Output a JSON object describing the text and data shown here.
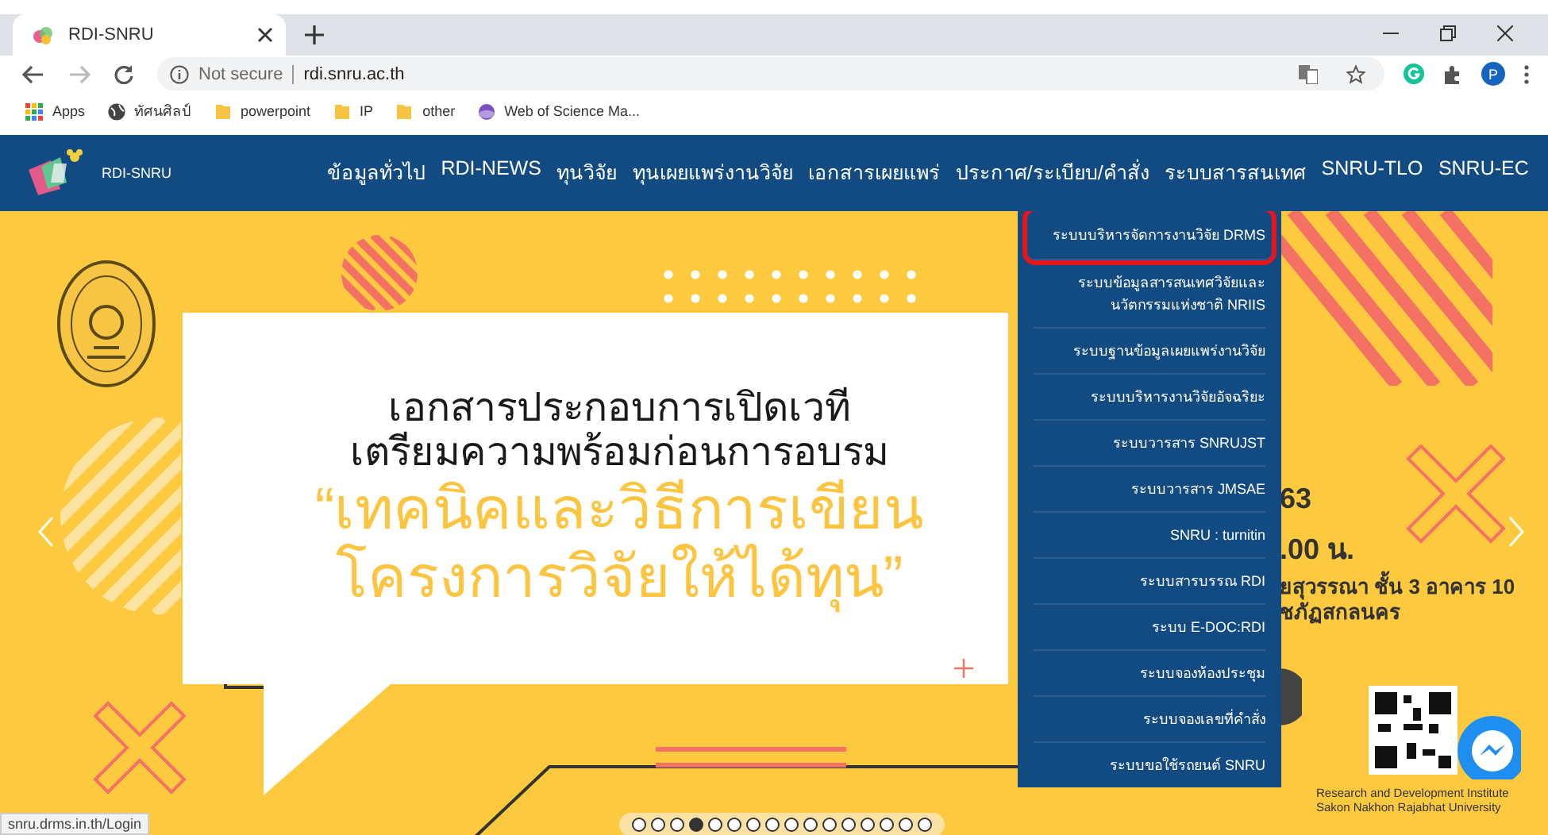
{
  "browser": {
    "tabs": [
      {
        "title": "RDI-SNRU",
        "selected": true
      }
    ],
    "address": {
      "security": "Not secure",
      "url": "rdi.snru.ac.th"
    },
    "bookmarks": [
      {
        "label": "Apps",
        "kind": "apps"
      },
      {
        "label": "ทัศนศิลป์",
        "kind": "globe"
      },
      {
        "label": "powerpoint",
        "kind": "folder"
      },
      {
        "label": "IP",
        "kind": "folder"
      },
      {
        "label": "other",
        "kind": "folder"
      },
      {
        "label": "Web of Science Ma...",
        "kind": "site"
      }
    ],
    "profile": "P",
    "status_url": "snru.drms.in.th/Login"
  },
  "site": {
    "logo_text": "RDI-SNRU",
    "nav": [
      "ข้อมูลทั่วไป",
      "RDI-NEWS",
      "ทุนวิจัย",
      "ทุนเผยแพร่งานวิจัย",
      "เอกสารเผยแพร่",
      "ประกาศ/ระเบียบ/คำสั่ง",
      "ระบบสารสนเทศ",
      "SNRU-TLO",
      "SNRU-EC"
    ],
    "dropdown": [
      {
        "label": "ระบบบริหารจัดการงานวิจัย DRMS",
        "highlighted": true
      },
      {
        "label": "ระบบข้อมูลสารสนเทศวิจัยและนวัตกรรมแห่งชาติ NRIIS",
        "highlighted": false
      },
      {
        "label": "ระบบฐานข้อมูลเผยแพร่งานวิจัย",
        "highlighted": false
      },
      {
        "label": "ระบบบริหารงานวิจัยอัจฉริยะ",
        "highlighted": false
      },
      {
        "label": "ระบบวารสาร SNRUJST",
        "highlighted": false
      },
      {
        "label": "ระบบวารสาร JMSAE",
        "highlighted": false
      },
      {
        "label": "SNRU : turnitin",
        "highlighted": false
      },
      {
        "label": "ระบบสารบรรณ RDI",
        "highlighted": false
      },
      {
        "label": "ระบบ E-DOC:RDI",
        "highlighted": false
      },
      {
        "label": "ระบบจองห้องประชุม",
        "highlighted": false
      },
      {
        "label": "ระบบจองเลขที่คำสั่ง",
        "highlighted": false
      },
      {
        "label": "ระบบขอใช้รถยนต์ SNRU",
        "highlighted": false
      }
    ]
  },
  "banner": {
    "lines": [
      {
        "text": "เอกสารประกอบการเปิดเวที",
        "kind": "dark"
      },
      {
        "text": "เตรียมความพร้อมก่อนการอบรม",
        "kind": "dark"
      },
      {
        "text": "“เทคนิคและวิธีการเขียน",
        "kind": "accent"
      },
      {
        "text": "โครงการวิจัยให้ได้ทุน”",
        "kind": "accent"
      }
    ],
    "side_texts": [
      {
        "text": "63",
        "kind": "big"
      },
      {
        "text": ".00 น.",
        "kind": "big"
      },
      {
        "text": "ยสุวรรณา ชั้น  3 อาคาร 10",
        "kind": "small"
      },
      {
        "text": "ชภัฏสกลนคร",
        "kind": "small"
      }
    ],
    "caption": [
      "Research and Development Institute",
      "Sakon Nakhon Rajabhat University"
    ],
    "dots": [
      {
        "selected": false
      },
      {
        "selected": false
      },
      {
        "selected": false
      },
      {
        "selected": true
      },
      {
        "selected": false
      },
      {
        "selected": false
      },
      {
        "selected": false
      },
      {
        "selected": false
      },
      {
        "selected": false
      },
      {
        "selected": false
      },
      {
        "selected": false
      },
      {
        "selected": false
      },
      {
        "selected": false
      },
      {
        "selected": false
      },
      {
        "selected": false
      },
      {
        "selected": false
      }
    ]
  }
}
